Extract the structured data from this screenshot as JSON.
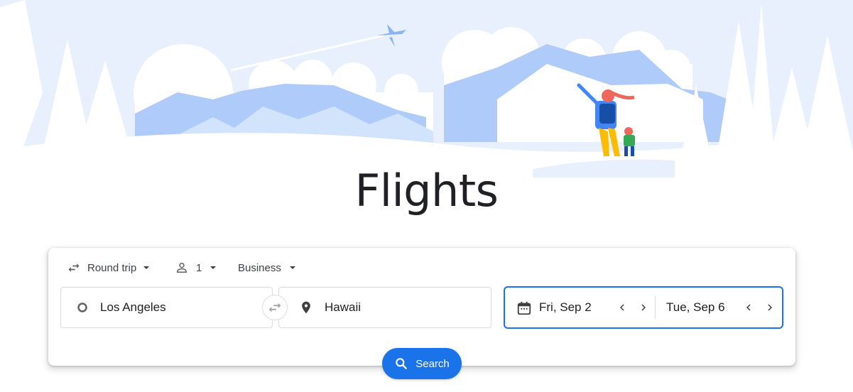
{
  "page": {
    "title": "Flights"
  },
  "options": {
    "trip_type": "Round trip",
    "passengers": "1",
    "cabin_class": "Business"
  },
  "route": {
    "origin": "Los Angeles",
    "destination": "Hawaii"
  },
  "dates": {
    "departure": "Fri, Sep 2",
    "return": "Tue, Sep 6"
  },
  "search": {
    "label": "Search"
  },
  "colors": {
    "accent": "#1a73e8",
    "sky": "#e8f0fe",
    "mountain": "#aecbfa",
    "text": "#202124"
  },
  "icons": {
    "trip_type": "swap-horiz-icon",
    "passengers": "person-icon",
    "origin": "circle-outline-icon",
    "destination": "location-pin-icon",
    "calendar": "calendar-icon",
    "search": "search-icon"
  }
}
